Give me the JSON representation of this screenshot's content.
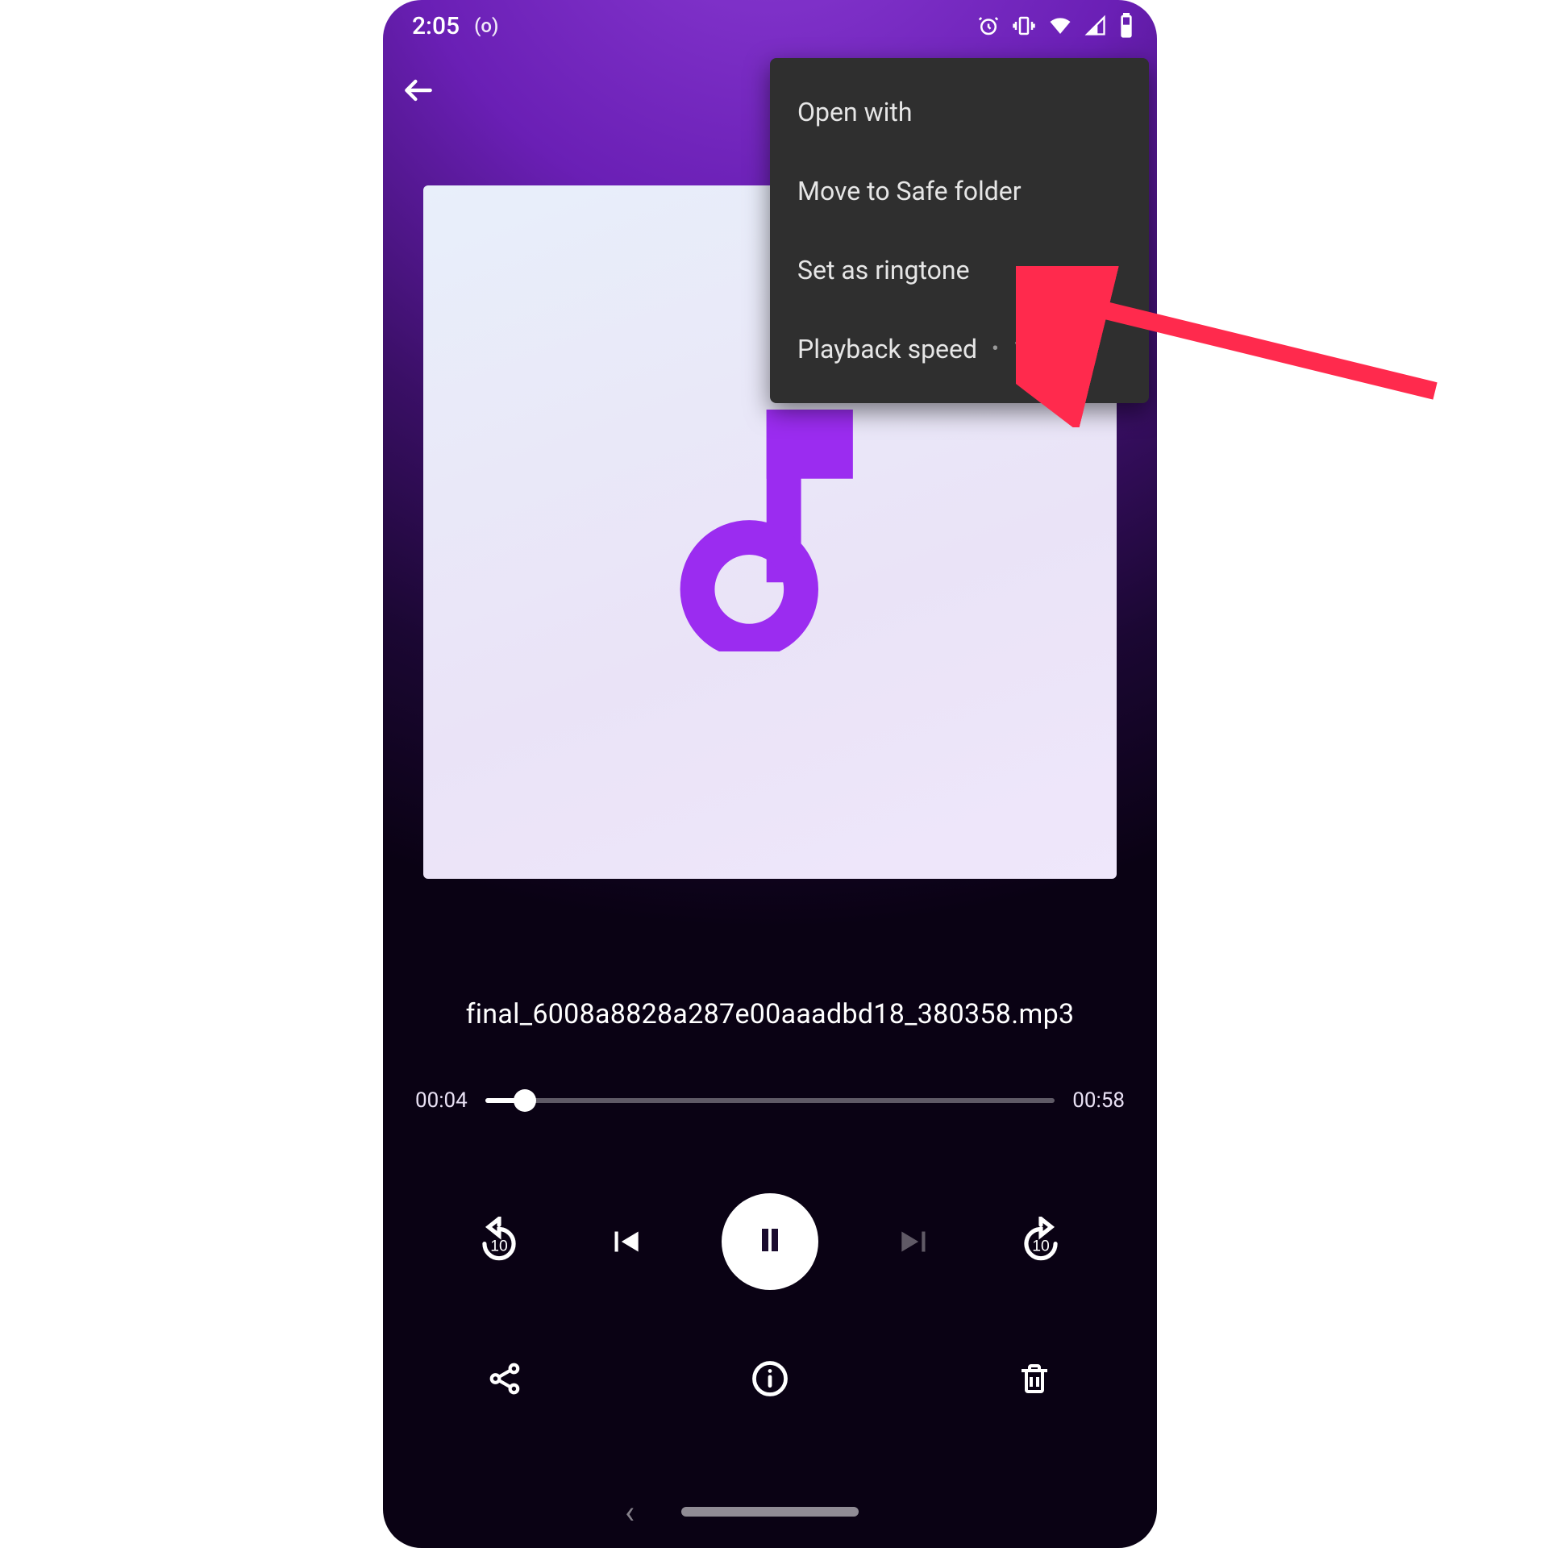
{
  "status": {
    "time": "2:05",
    "cast_indicator": "(o)"
  },
  "menu": {
    "items": [
      {
        "label": "Open with"
      },
      {
        "label": "Move to Safe folder"
      },
      {
        "label": "Set as ringtone"
      },
      {
        "label": "Playback speed",
        "value": "1.0x"
      }
    ]
  },
  "track": {
    "title": "final_6008a8828a287e00aaadbd18_380358.mp3",
    "elapsed": "00:04",
    "total": "00:58",
    "progress_pct": 7
  },
  "controls": {
    "rewind_amount": "10",
    "forward_amount": "10"
  },
  "colors": {
    "accent": "#9b2cf0",
    "menu_bg": "#2f2f2f",
    "annotation": "#ff2a4d"
  }
}
